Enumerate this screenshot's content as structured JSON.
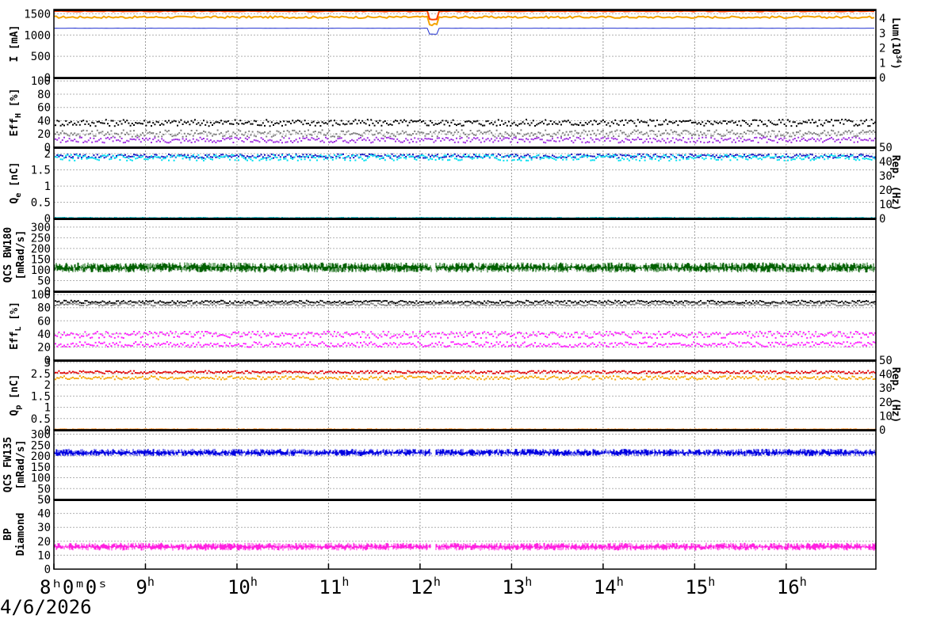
{
  "date_label": "4/6/2026",
  "chart_data": {
    "type": "line",
    "x_axis": {
      "start_hour": 8,
      "end_hour": 16.98,
      "first_tick_label": "8ʰ0ᵐ0ˢ",
      "tick_labels": [
        "8",
        "9",
        "10",
        "11",
        "12",
        "13",
        "14",
        "15",
        "16"
      ],
      "hour_suffix": "h"
    },
    "grid": true,
    "panels": [
      {
        "id": "current",
        "left_label": "I [mA]",
        "right_label": "Lum(10",
        "right_label_sup": "34",
        "right_label_end": ")",
        "ylim": [
          0,
          1600
        ],
        "left_ticks": [
          "0",
          "500",
          "1000",
          "1500"
        ],
        "right_ticks": [
          "0",
          "1",
          "2",
          "3",
          "4"
        ],
        "right_ylim": [
          0,
          4.6
        ],
        "series": [
          {
            "kind": "line",
            "color": "#f4a300",
            "level": 1420,
            "noise": 25
          },
          {
            "kind": "line",
            "color": "#ff4000",
            "level": 1560,
            "noise": 10
          },
          {
            "kind": "line",
            "color": "#2030d0",
            "level": 1160,
            "noise": 2
          },
          {
            "kind": "line",
            "color": "#000000",
            "level": 1600,
            "noise": 0
          }
        ]
      },
      {
        "id": "effh",
        "left_label": "Eff",
        "left_label_sub": "H",
        "left_label_end": " [%]",
        "ylim": [
          0,
          105
        ],
        "left_ticks": [
          "0",
          "20",
          "40",
          "60",
          "80",
          "100"
        ],
        "series": [
          {
            "kind": "dots",
            "color": "#000000",
            "level": 38,
            "noise": 5
          },
          {
            "kind": "dots",
            "color": "#808080",
            "level": 22,
            "noise": 5
          },
          {
            "kind": "dots",
            "color": "#a030e0",
            "level": 12,
            "noise": 4
          }
        ]
      },
      {
        "id": "qe",
        "left_label": "Q",
        "left_label_sub": "e",
        "left_label_end": " [nC]",
        "right_label": "Rep. (Hz)",
        "ylim": [
          0,
          2.2
        ],
        "left_ticks": [
          "0",
          "0.5",
          "1",
          "1.5",
          "2"
        ],
        "right_ticks": [
          "0",
          "10",
          "20",
          "30",
          "40",
          "50"
        ],
        "right_ylim": [
          0,
          50
        ],
        "series": [
          {
            "kind": "dots",
            "color": "#1010c0",
            "level": 1.95,
            "noise": 0.06
          },
          {
            "kind": "dots",
            "color": "#00e0f0",
            "level": 1.9,
            "noise": 0.09
          },
          {
            "kind": "dots",
            "color": "#00c0d0",
            "level": 0.04,
            "noise": 0.01
          }
        ]
      },
      {
        "id": "bw180",
        "left_label": "QCS BW180",
        "left_label_2": "[mRad/s]",
        "ylim": [
          0,
          340
        ],
        "left_ticks": [
          "0",
          "50",
          "100",
          "150",
          "200",
          "250",
          "300"
        ],
        "series": [
          {
            "kind": "bars",
            "color": "#006000",
            "level": 110,
            "noise": 25
          }
        ]
      },
      {
        "id": "effl",
        "left_label": "Eff",
        "left_label_sub": "L",
        "left_label_end": " [%]",
        "ylim": [
          0,
          105
        ],
        "left_ticks": [
          "0",
          "20",
          "40",
          "60",
          "80",
          "100"
        ],
        "series": [
          {
            "kind": "dots",
            "color": "#000000",
            "level": 90,
            "noise": 2
          },
          {
            "kind": "dots",
            "color": "#808080",
            "level": 86,
            "noise": 2
          },
          {
            "kind": "dots",
            "color": "#ff20ff",
            "level": 40,
            "noise": 5
          },
          {
            "kind": "dots",
            "color": "#ff20ff",
            "level": 25,
            "noise": 4
          }
        ]
      },
      {
        "id": "qp",
        "left_label": "Q",
        "left_label_sub": "p",
        "left_label_end": " [nC]",
        "right_label": "Rep. (Hz)",
        "ylim": [
          0,
          3.1
        ],
        "left_ticks": [
          "0",
          "0.5",
          "1",
          "1.5",
          "2",
          "2.5",
          "3"
        ],
        "right_ticks": [
          "0",
          "10",
          "20",
          "30",
          "40",
          "50"
        ],
        "right_ylim": [
          0,
          50
        ],
        "series": [
          {
            "kind": "dots",
            "color": "#f4a300",
            "level": 2.35,
            "noise": 0.08
          },
          {
            "kind": "dots",
            "color": "#e00000",
            "level": 2.6,
            "noise": 0.06
          },
          {
            "kind": "dots",
            "color": "#ff8000",
            "level": 0.05,
            "noise": 0.01
          }
        ]
      },
      {
        "id": "fw135",
        "left_label": "QCS FW135",
        "left_label_2": "[mRad/s]",
        "ylim": [
          0,
          320
        ],
        "left_ticks": [
          "0",
          "50",
          "100",
          "150",
          "200",
          "250",
          "300"
        ],
        "series": [
          {
            "kind": "bars",
            "color": "#0000e0",
            "level": 215,
            "noise": 18
          }
        ]
      },
      {
        "id": "bp",
        "left_label": "BP",
        "left_label_2": "Diamond",
        "ylim": [
          0,
          50
        ],
        "left_ticks": [
          "0",
          "10",
          "20",
          "30",
          "40",
          "50"
        ],
        "series": [
          {
            "kind": "bars",
            "color": "#ff20e0",
            "level": 16,
            "noise": 3
          }
        ]
      }
    ]
  }
}
